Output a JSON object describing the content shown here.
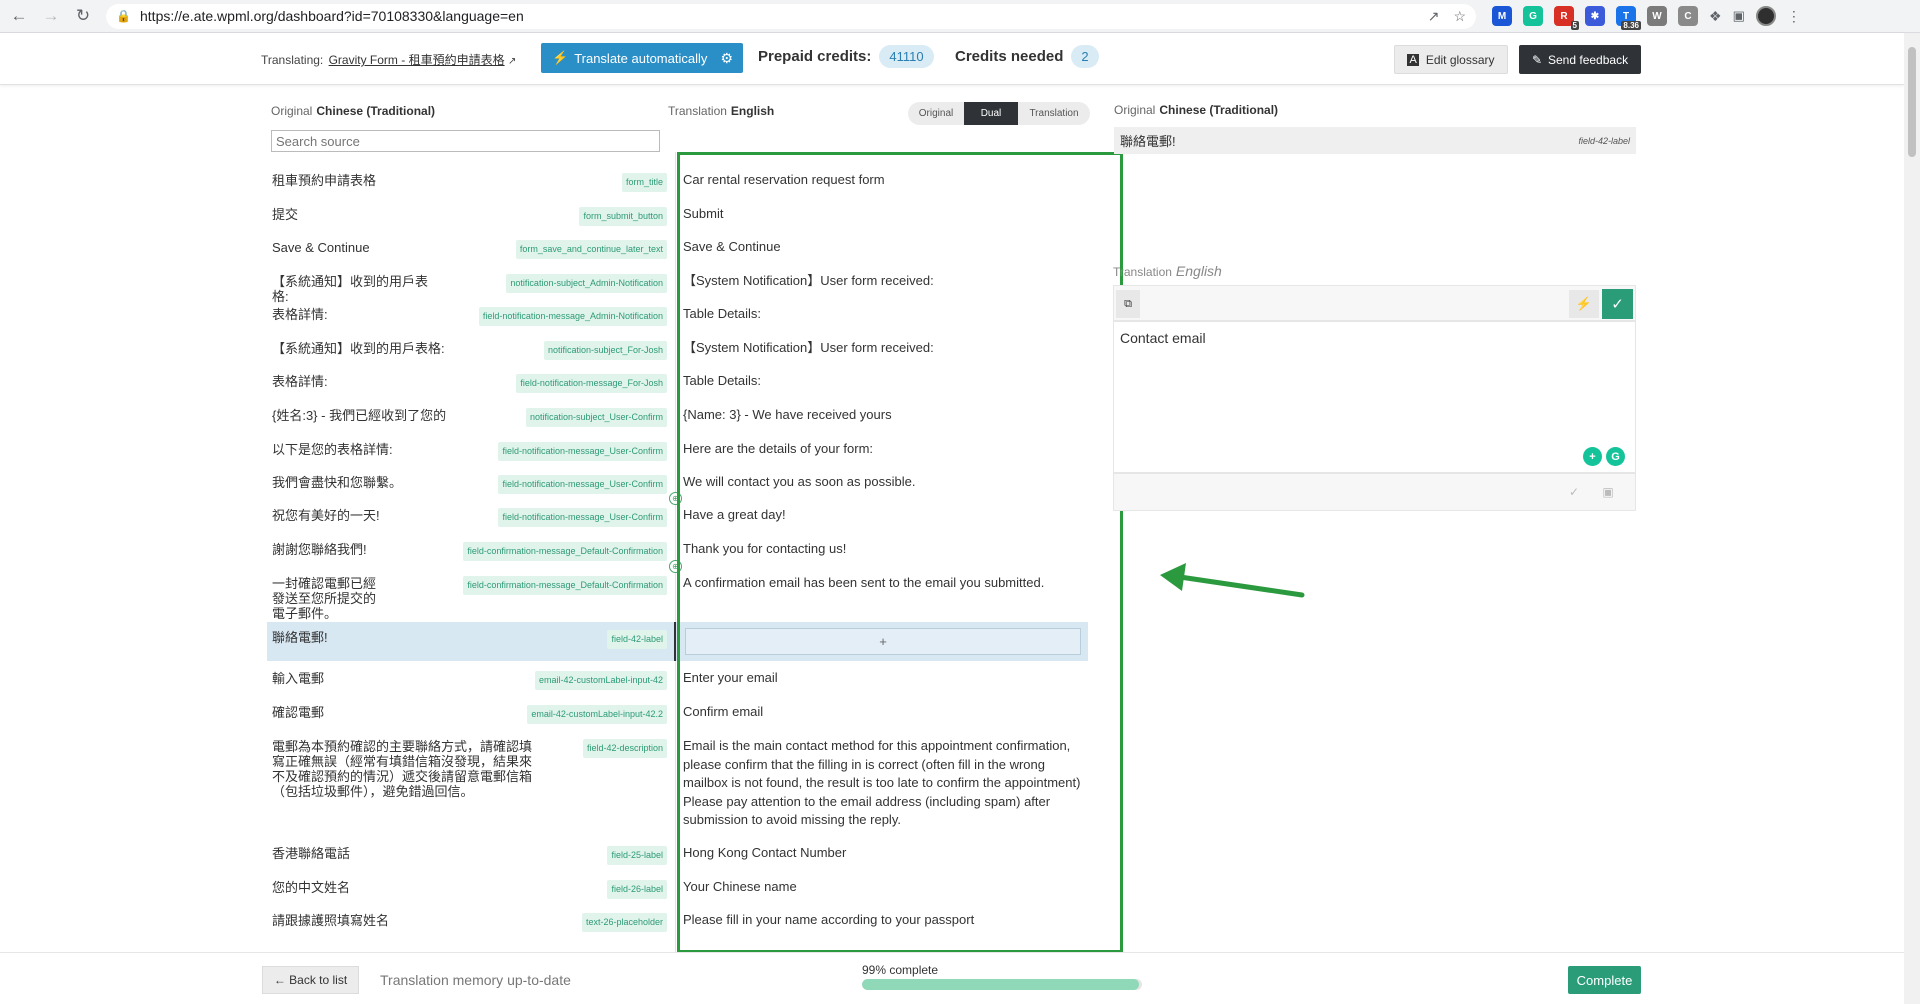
{
  "browser": {
    "url": "https://e.ate.wpml.org/dashboard?id=70108330&language=en",
    "extensions": [
      {
        "icon": "malwarebytes-icon",
        "label": "M",
        "color": "#1a56d6",
        "badge": ""
      },
      {
        "icon": "grammarly-icon",
        "label": "G",
        "color": "#15c39a",
        "badge": ""
      },
      {
        "icon": "redlist-icon",
        "label": "R",
        "color": "#d93025",
        "badge": "5"
      },
      {
        "icon": "snowflake-icon",
        "label": "✱",
        "color": "#3b5bdb",
        "badge": ""
      },
      {
        "icon": "tools-icon",
        "label": "T",
        "color": "#1a73e8",
        "badge": "8.36"
      },
      {
        "icon": "wordpress-w-icon",
        "label": "W",
        "color": "#7b7b7b",
        "badge": ""
      },
      {
        "icon": "c-extension-icon",
        "label": "C",
        "color": "#8a8a8a",
        "badge": ""
      }
    ]
  },
  "header": {
    "translating_label": "Translating:",
    "job_link": "Gravity Form - 租車預約申請表格",
    "translate_btn": "Translate automatically",
    "prepaid_label": "Prepaid credits:",
    "prepaid_value": "41110",
    "needed_label": "Credits needed",
    "needed_value": "2",
    "glossary_btn": "Edit glossary",
    "feedback_btn": "Send feedback"
  },
  "columns": {
    "original_label": "Original",
    "original_lang": "Chinese (Traditional)",
    "search_placeholder": "Search source",
    "translation_label": "Translation",
    "translation_lang": "English",
    "view_options": [
      "Original",
      "Dual",
      "Translation"
    ],
    "active_view": "Dual"
  },
  "rows": [
    {
      "source": "租車預約申請表格",
      "tag": "form_title",
      "target": "Car rental reservation request form"
    },
    {
      "source": "提交",
      "tag": "form_submit_button",
      "target": "Submit"
    },
    {
      "source": "Save & Continue",
      "tag": "form_save_and_continue_later_text",
      "target": "Save & Continue"
    },
    {
      "source": "【系統通知】收到的用戶表格:",
      "tag": "notification-subject_Admin-Notification",
      "target": "【System Notification】User form received:"
    },
    {
      "source": "表格詳情:",
      "tag": "field-notification-message_Admin-Notification",
      "target": "Table Details:"
    },
    {
      "source": "【系統通知】收到的用戶表格:",
      "tag": "notification-subject_For-Josh",
      "target": "【System Notification】User form received:"
    },
    {
      "source": "表格詳情:",
      "tag": "field-notification-message_For-Josh",
      "target": "Table Details:"
    },
    {
      "source": "{姓名:3} - 我們已經收到了您的",
      "tag": "notification-subject_User-Confirm",
      "target": "{Name: 3} - We have received yours"
    },
    {
      "source": "以下是您的表格詳情:",
      "tag": "field-notification-message_User-Confirm",
      "target": "Here are the details of your form:"
    },
    {
      "source": "我們會盡快和您聯繫。",
      "tag": "field-notification-message_User-Confirm",
      "target": "We will contact you as soon as possible."
    },
    {
      "source": "祝您有美好的一天!",
      "tag": "field-notification-message_User-Confirm",
      "target": "Have a great day!"
    },
    {
      "source": "謝謝您聯絡我們!",
      "tag": "field-confirmation-message_Default-Confirmation",
      "target": "Thank you for contacting us!"
    },
    {
      "source": "一封確認電郵已經發送至您所提交的電子郵件。",
      "tag": "field-confirmation-message_Default-Confirmation",
      "target": "A confirmation email has been sent to the email you submitted."
    },
    {
      "source": "聯絡電郵!",
      "tag": "field-42-label",
      "target": "+"
    },
    {
      "source": "輸入電郵",
      "tag": "email-42-customLabel-input-42",
      "target": "Enter your email"
    },
    {
      "source": "確認電郵",
      "tag": "email-42-customLabel-input-42.2",
      "target": "Confirm email"
    },
    {
      "source": "電郵為本預約確認的主要聯絡方式，請確認填寫正確無誤（經常有填錯信箱沒發現，結果來不及確認預約的情況）遞交後請留意電郵信箱（包括垃圾郵件），避免錯過回信。",
      "tag": "field-42-description",
      "target": "Email is the main contact method for this appointment confirmation, please confirm that the filling in is correct (often fill in the wrong mailbox is not found, the result is too late to confirm the appointment) Please pay attention to the email address (including spam) after submission to avoid missing the reply."
    },
    {
      "source": "香港聯絡電話",
      "tag": "field-25-label",
      "target": "Hong Kong Contact Number"
    },
    {
      "source": "您的中文姓名",
      "tag": "field-26-label",
      "target": "Your Chinese name"
    },
    {
      "source": "請跟據護照填寫姓名",
      "tag": "text-26-placeholder",
      "target": "Please fill in your name according to your passport"
    }
  ],
  "right_panel": {
    "original_label": "Original",
    "original_lang": "Chinese (Traditional)",
    "source_text": "聯絡電郵!",
    "source_tag": "field-42-label",
    "translation_label": "Translation",
    "translation_lang": "English",
    "translation_value": "Contact email"
  },
  "footer": {
    "back_btn": "← Back to list",
    "tm_status": "Translation memory up-to-date",
    "progress_label": "99% complete",
    "progress_value": 99,
    "complete_btn": "Complete"
  },
  "colors": {
    "accent_blue": "#2a8ec7",
    "accent_green": "#2a9d78",
    "highlight_green": "#2b9a3e"
  }
}
